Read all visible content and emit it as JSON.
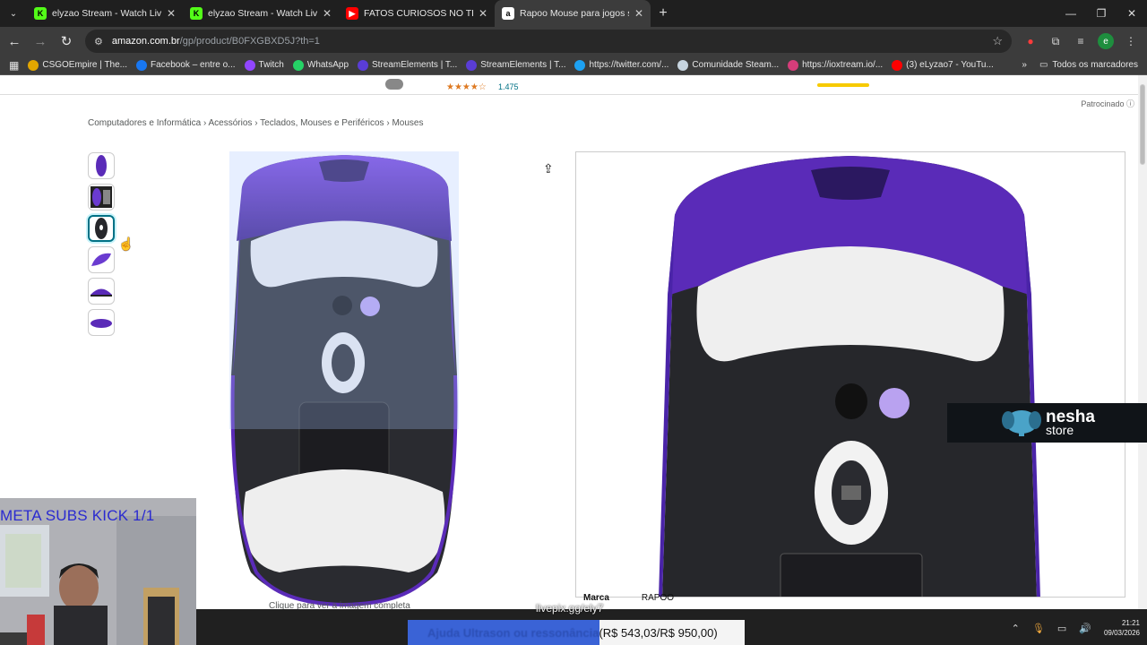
{
  "tabs": [
    {
      "title": "elyzao Stream - Watch Live on Kick",
      "icon": "kick-icon",
      "active": false
    },
    {
      "title": "elyzao Stream - Watch Live on Kick",
      "icon": "kick-icon",
      "active": false
    },
    {
      "title": "FATOS CURIOSOS NO TRÂNSITO",
      "icon": "youtube-icon",
      "active": false
    },
    {
      "title": "Rapoo Mouse para jogos sem fio",
      "icon": "amazon-icon",
      "active": true
    }
  ],
  "address": {
    "domain": "amazon.com.br",
    "path": "/gp/product/B0FXGBXD5J?th=1"
  },
  "bookmarks": [
    {
      "label": "CSGOEmpire | The...",
      "color": "#e2a600"
    },
    {
      "label": "Facebook – entre o...",
      "color": "#1877f2"
    },
    {
      "label": "Twitch",
      "color": "#9146ff"
    },
    {
      "label": "WhatsApp",
      "color": "#25d366"
    },
    {
      "label": "StreamElements | T...",
      "color": "#5a3dd6"
    },
    {
      "label": "StreamElements | T...",
      "color": "#5a3dd6"
    },
    {
      "label": "https://twitter.com/...",
      "color": "#1da1f2"
    },
    {
      "label": "Comunidade Steam...",
      "color": "#c7d5e0"
    },
    {
      "label": "https://ioxtream.io/...",
      "color": "#d63d7a"
    },
    {
      "label": "(3) eLyzao7 - YouTu...",
      "color": "#ff0000"
    }
  ],
  "bookmarks_all": "Todos os marcadores",
  "product": {
    "stars": "★★★★☆",
    "rating_count": "1.475",
    "sponsored": "Patrocinado",
    "breadcrumb": [
      "Computadores e Informática",
      "Acessórios",
      "Teclados, Mouses e Periféricos",
      "Mouses"
    ],
    "click_hint": "Clique para ver a imagem completa",
    "spec_label": "Marca",
    "spec_value": "RAPOO"
  },
  "overlay": {
    "meta": "META SUBS KICK 1/1",
    "nesha_1": "nesha",
    "nesha_2": "store",
    "livepix": "livepix.gg/ely7",
    "goal_label": "Ajuda Ultrason ou ressonância",
    "goal_amount": "(R$ 543,03/R$ 950,00)",
    "goal_fraction": 0.57
  },
  "system": {
    "time": "21:21",
    "date": "09/03/2026"
  },
  "colors": {
    "mouse_purple": "#5a2bb8",
    "mouse_black": "#26272b",
    "accent": "#3a63d6"
  }
}
